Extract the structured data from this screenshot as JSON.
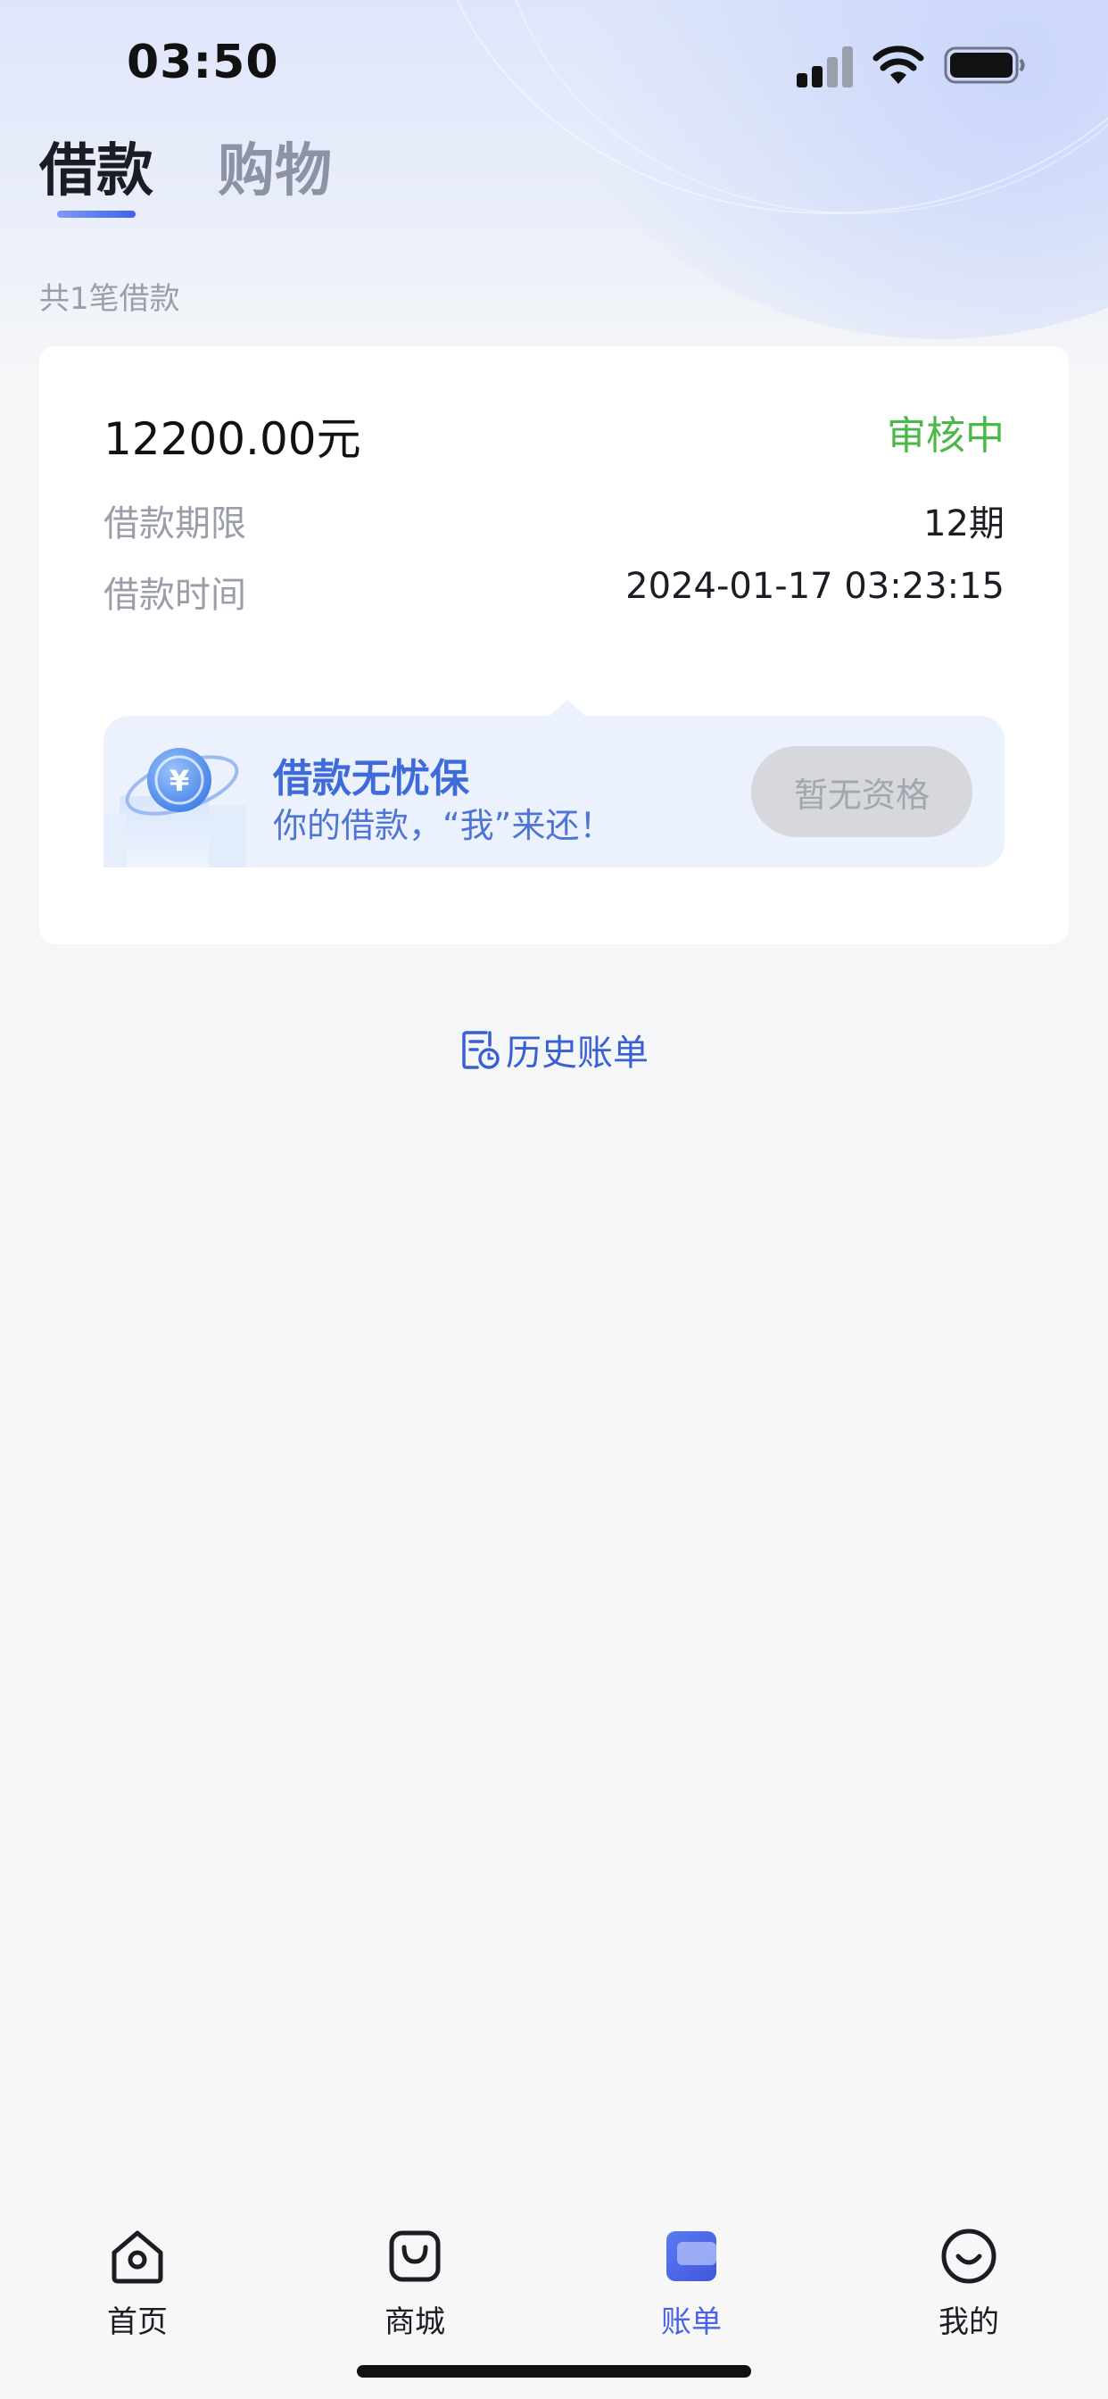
{
  "status_bar": {
    "time": "03:50"
  },
  "tabs": [
    {
      "label": "借款",
      "active": true
    },
    {
      "label": "购物",
      "active": false
    }
  ],
  "summary": "共1笔借款",
  "loan_card": {
    "amount": "12200.00元",
    "status": "审核中",
    "status_color": "#4cb84a",
    "rows": [
      {
        "label": "借款期限",
        "value": "12期"
      },
      {
        "label": "借款时间",
        "value": "2024-01-17 03:23:15"
      }
    ],
    "promo": {
      "title": "借款无忧保",
      "subtitle": "你的借款，“我”来还！",
      "button_label": "暂无资格",
      "icon": "yuan-coin-icon"
    }
  },
  "history": {
    "label": "历史账单",
    "icon": "bill-history-icon"
  },
  "bottom_nav": [
    {
      "label": "首页",
      "icon": "home-icon",
      "active": false
    },
    {
      "label": "商城",
      "icon": "shopping-bag-icon",
      "active": false
    },
    {
      "label": "账单",
      "icon": "bill-icon",
      "active": true
    },
    {
      "label": "我的",
      "icon": "smiley-profile-icon",
      "active": false
    }
  ],
  "colors": {
    "accent": "#4a62e8",
    "link": "#3a5fd4",
    "promo_text": "#3e6bd8"
  }
}
